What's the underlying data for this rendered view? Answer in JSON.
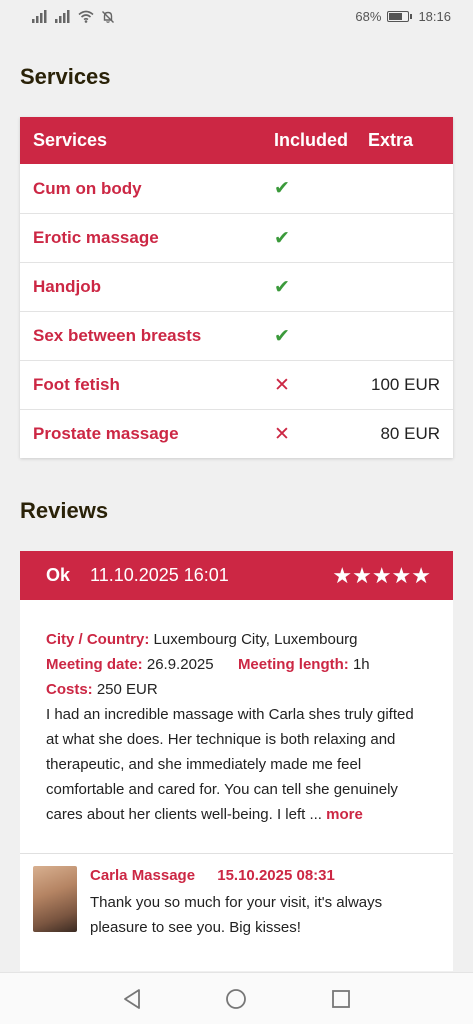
{
  "status_bar": {
    "battery": "68%",
    "time": "18:16",
    "battery_level": 0.68
  },
  "services": {
    "title": "Services",
    "headers": {
      "name": "Services",
      "included": "Included",
      "extra": "Extra"
    },
    "rows": [
      {
        "name": "Cum on body",
        "included": "✔",
        "extra": ""
      },
      {
        "name": "Erotic massage",
        "included": "✔",
        "extra": ""
      },
      {
        "name": "Handjob",
        "included": "✔",
        "extra": ""
      },
      {
        "name": "Sex between breasts",
        "included": "✔",
        "extra": ""
      },
      {
        "name": "Foot fetish",
        "included": "✕",
        "extra": "100 EUR"
      },
      {
        "name": "Prostate massage",
        "included": "✕",
        "extra": "80 EUR"
      }
    ]
  },
  "reviews": {
    "title": "Reviews",
    "items": [
      {
        "rating_text": "Ok",
        "date": "11.10.2025 16:01",
        "stars": "★★★★★",
        "city_label": "City / Country:",
        "city_value": "Luxembourg City, Luxembourg",
        "meeting_date_label": "Meeting date:",
        "meeting_date_value": "26.9.2025",
        "meeting_length_label": "Meeting length:",
        "meeting_length_value": "1h",
        "costs_label": "Costs:",
        "costs_value": "250 EUR",
        "text": "I had an incredible massage with Carla shes truly gifted at what she does. Her technique is both relaxing and therapeutic, and she immediately made me feel comfortable and cared for. You can tell she genuinely cares about her clients well-being. I left ...",
        "more_label": "more",
        "reply": {
          "author": "Carla Massage",
          "date": "15.10.2025 08:31",
          "text": "Thank you so much for your visit, it's always pleasure to see you. Big kisses!"
        }
      }
    ]
  },
  "colors": {
    "accent": "#cc2744",
    "check": "#3b9a3b",
    "background": "#f0f0f0"
  }
}
